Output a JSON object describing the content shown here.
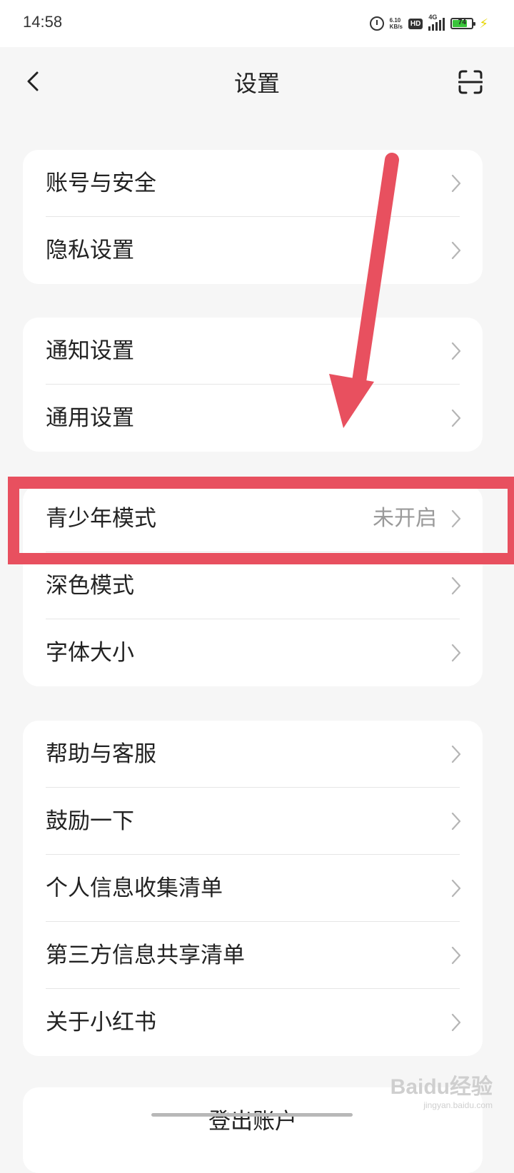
{
  "status_bar": {
    "time": "14:58",
    "net_speed_value": "6.10",
    "net_speed_unit": "KB/s",
    "hd_badge": "HD",
    "network": "4G",
    "battery": "74",
    "icons": [
      "alarm-icon",
      "hd-icon",
      "signal-icon",
      "battery-icon",
      "charging-icon"
    ]
  },
  "header": {
    "title": "设置",
    "back_icon": "chevron-left-icon",
    "scan_icon": "scan-icon"
  },
  "groups": [
    {
      "items": [
        {
          "label": "账号与安全"
        },
        {
          "label": "隐私设置"
        }
      ]
    },
    {
      "items": [
        {
          "label": "通知设置"
        },
        {
          "label": "通用设置"
        }
      ]
    },
    {
      "items": [
        {
          "label": "青少年模式",
          "value": "未开启"
        },
        {
          "label": "深色模式"
        },
        {
          "label": "字体大小"
        }
      ]
    },
    {
      "items": [
        {
          "label": "帮助与客服"
        },
        {
          "label": "鼓励一下"
        },
        {
          "label": "个人信息收集清单"
        },
        {
          "label": "第三方信息共享清单"
        },
        {
          "label": "关于小红书"
        }
      ]
    }
  ],
  "logout": {
    "label": "登出账户"
  },
  "annotation": {
    "color": "#e8505f"
  },
  "watermark": {
    "main": "Baidu经验",
    "sub": "jingyan.baidu.com"
  },
  "colors": {
    "background": "#f6f6f6",
    "card": "#ffffff",
    "accent": "#e8505f",
    "value_text": "#9a9a9a"
  }
}
